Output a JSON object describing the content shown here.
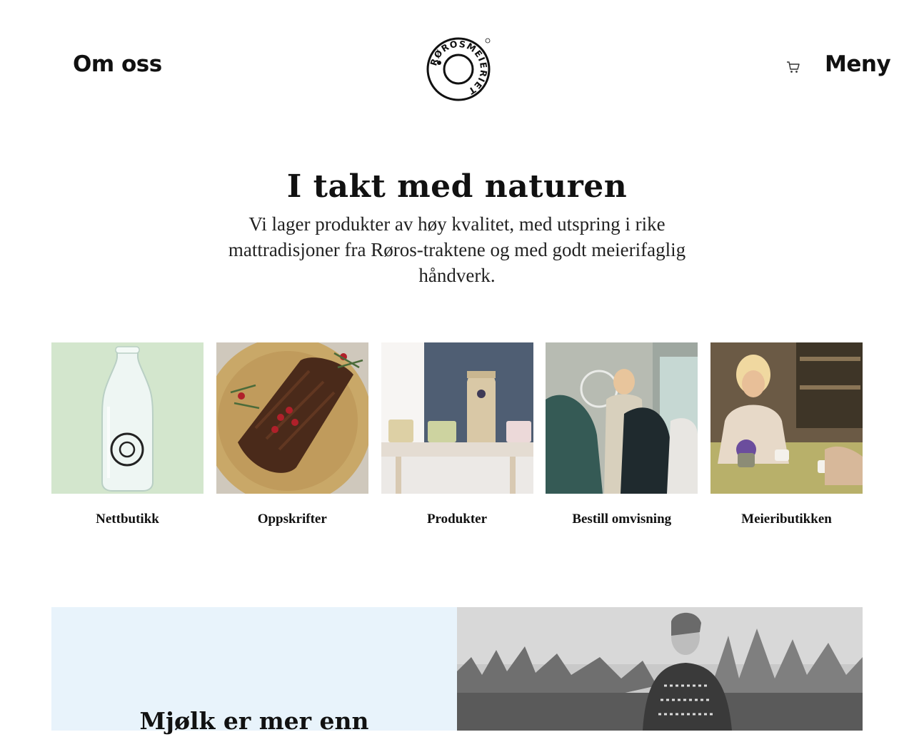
{
  "header": {
    "about_label": "Om oss",
    "menu_label": "Meny",
    "logo_text": "RØROSMEIERIET",
    "cart_icon": "shopping-cart-icon"
  },
  "hero": {
    "title": "I takt med naturen",
    "text": "Vi lager produkter av høy kvalitet, med utspring i rike mattradisjoner fra Røros-traktene og med godt meierifaglig håndverk."
  },
  "tiles": [
    {
      "label": "Nettbutikk",
      "bg": "#d3e6cd"
    },
    {
      "label": "Oppskrifter",
      "bg": "#b9a780"
    },
    {
      "label": "Produkter",
      "bg": "#e6e3df"
    },
    {
      "label": "Bestill omvisning",
      "bg": "#8b9288"
    },
    {
      "label": "Meieributikken",
      "bg": "#7c6a52"
    }
  ],
  "feature": {
    "title": "Mjølk er mer enn",
    "bg": "#e8f3fb"
  },
  "colors": {
    "text": "#111111",
    "feature_bg": "#e8f3fb"
  }
}
